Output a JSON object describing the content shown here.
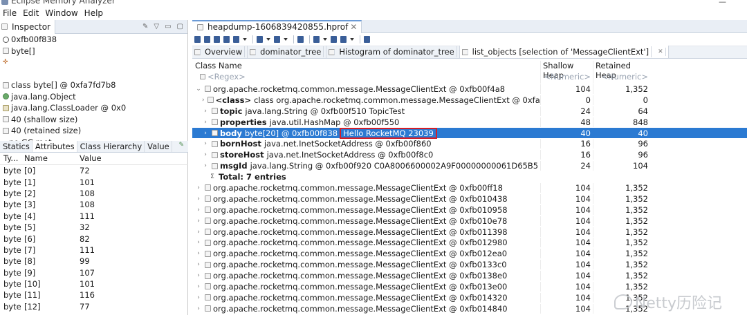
{
  "window": {
    "title": "Eclipse Memory Analyzer"
  },
  "menu": [
    "File",
    "Edit",
    "Window",
    "Help"
  ],
  "inspector": {
    "tab_label": "Inspector",
    "address": "0xfb00f838",
    "type": "byte[]",
    "class_line": "class byte[] @ 0xfa7fd7b8",
    "super_line": "java.lang.Object",
    "loader_line": "java.lang.ClassLoader @ 0x0",
    "shallow_line": "40 (shallow size)",
    "retained_line": "40 (retained size)",
    "gc_line": "no GC root",
    "tabs": [
      "Statics",
      "Attributes",
      "Class Hierarchy",
      "Value"
    ],
    "columns": [
      "Ty...",
      "Name",
      "Value"
    ],
    "attributes": [
      {
        "type": "byte",
        "name": "[0]",
        "value": "72"
      },
      {
        "type": "byte",
        "name": "[1]",
        "value": "101"
      },
      {
        "type": "byte",
        "name": "[2]",
        "value": "108"
      },
      {
        "type": "byte",
        "name": "[3]",
        "value": "108"
      },
      {
        "type": "byte",
        "name": "[4]",
        "value": "111"
      },
      {
        "type": "byte",
        "name": "[5]",
        "value": "32"
      },
      {
        "type": "byte",
        "name": "[6]",
        "value": "82"
      },
      {
        "type": "byte",
        "name": "[7]",
        "value": "111"
      },
      {
        "type": "byte",
        "name": "[8]",
        "value": "99"
      },
      {
        "type": "byte",
        "name": "[9]",
        "value": "107"
      },
      {
        "type": "byte",
        "name": "[10]",
        "value": "101"
      },
      {
        "type": "byte",
        "name": "[11]",
        "value": "116"
      },
      {
        "type": "byte",
        "name": "[12]",
        "value": "77"
      }
    ]
  },
  "editor": {
    "file_tab": "heapdump-1606839420855.hprof",
    "subtabs": [
      "Overview",
      "dominator_tree",
      "Histogram of dominator_tree",
      "list_objects  [selection of 'MessageClientExt']"
    ],
    "columns": {
      "name": "Class Name",
      "shallow": "Shallow Heap",
      "retained": "Retained Heap"
    },
    "filter": {
      "name": "<Regex>",
      "shallow": "<Numeric>",
      "retained": "<Numeric>"
    },
    "root": {
      "label": "org.apache.rocketmq.common.message.MessageClientExt @ 0xfb00f4a8",
      "shallow": "104",
      "retained": "1,352"
    },
    "children": [
      {
        "field": "<class>",
        "rest": "class org.apache.rocketmq.common.message.MessageClientExt @ 0xfafa5738",
        "shallow": "0",
        "retained": "0"
      },
      {
        "field": "topic",
        "rest": "java.lang.String @ 0xfb00f510  TopicTest",
        "shallow": "24",
        "retained": "64"
      },
      {
        "field": "properties",
        "rest": "java.util.HashMap @ 0xfb00f550",
        "shallow": "48",
        "retained": "848"
      },
      {
        "field": "body",
        "rest": "byte[20] @ 0xfb00f838",
        "value": "Hello RocketMQ 23039",
        "shallow": "40",
        "retained": "40"
      },
      {
        "field": "bornHost",
        "rest": "java.net.InetSocketAddress @ 0xfb00f860",
        "shallow": "16",
        "retained": "96"
      },
      {
        "field": "storeHost",
        "rest": "java.net.InetSocketAddress @ 0xfb00f8c0",
        "shallow": "16",
        "retained": "96"
      },
      {
        "field": "msgId",
        "rest": "java.lang.String @ 0xfb00f920  C0A8006600002A9F00000000061D65B5",
        "shallow": "24",
        "retained": "104"
      }
    ],
    "total": "Total: 7 entries",
    "others": [
      {
        "label": "org.apache.rocketmq.common.message.MessageClientExt @ 0xfb00ff18",
        "shallow": "104",
        "retained": "1,352"
      },
      {
        "label": "org.apache.rocketmq.common.message.MessageClientExt @ 0xfb010438",
        "shallow": "104",
        "retained": "1,352"
      },
      {
        "label": "org.apache.rocketmq.common.message.MessageClientExt @ 0xfb010958",
        "shallow": "104",
        "retained": "1,352"
      },
      {
        "label": "org.apache.rocketmq.common.message.MessageClientExt @ 0xfb010e78",
        "shallow": "104",
        "retained": "1,352"
      },
      {
        "label": "org.apache.rocketmq.common.message.MessageClientExt @ 0xfb011398",
        "shallow": "104",
        "retained": "1,352"
      },
      {
        "label": "org.apache.rocketmq.common.message.MessageClientExt @ 0xfb012980",
        "shallow": "104",
        "retained": "1,352"
      },
      {
        "label": "org.apache.rocketmq.common.message.MessageClientExt @ 0xfb012ea0",
        "shallow": "104",
        "retained": "1,352"
      },
      {
        "label": "org.apache.rocketmq.common.message.MessageClientExt @ 0xfb0133c0",
        "shallow": "104",
        "retained": "1,352"
      },
      {
        "label": "org.apache.rocketmq.common.message.MessageClientExt @ 0xfb0138e0",
        "shallow": "104",
        "retained": "1,352"
      },
      {
        "label": "org.apache.rocketmq.common.message.MessageClientExt @ 0xfb013e00",
        "shallow": "104",
        "retained": "1,352"
      },
      {
        "label": "org.apache.rocketmq.common.message.MessageClientExt @ 0xfb014320",
        "shallow": "104",
        "retained": "1,352"
      },
      {
        "label": "org.apache.rocketmq.common.message.MessageClientExt @ 0xfb014840",
        "shallow": "104",
        "retained": "1,352"
      }
    ]
  },
  "watermark": "Netty历险记",
  "colors": {
    "selection": "#2b7ad2",
    "highlight_box": "#d21f2a"
  }
}
